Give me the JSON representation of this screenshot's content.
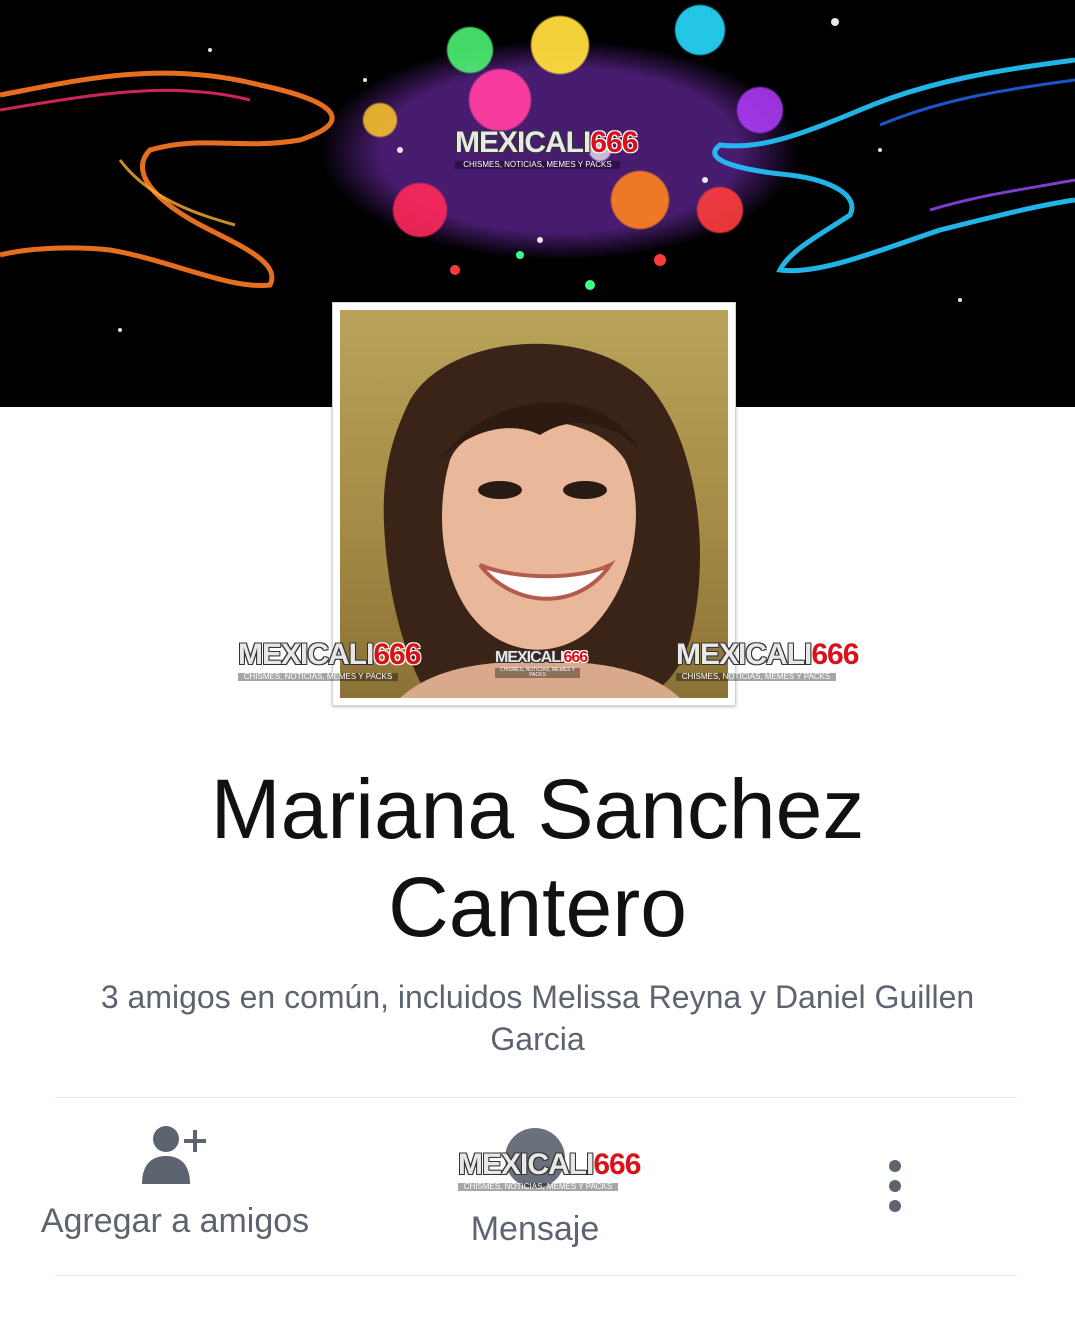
{
  "cover": {
    "watermark": {
      "brand": "MEXICALI",
      "number": "666",
      "tagline": "CHISMES, NOTICIAS, MEMES Y PACKS"
    }
  },
  "avatar": {
    "watermarks": [
      {
        "brand": "MEXICALI",
        "number": "666",
        "tagline": "CHISMES, NOTICIAS, MEMES Y PACKS"
      },
      {
        "brand": "MEXICALI",
        "number": "666",
        "tagline": "CHISMES, NOTICIAS, MEMES Y PACKS"
      },
      {
        "brand": "MEXICALI",
        "number": "666",
        "tagline": "CHISMES, NOTICIAS, MEMES Y PACKS"
      }
    ]
  },
  "profile": {
    "name_line1": "Mariana Sanchez",
    "name_line2": "Cantero",
    "mutual_line1": "3 amigos en común, incluidos Melissa Reyna y Daniel Guillen",
    "mutual_line2": "Garcia"
  },
  "actions": {
    "add_friend": {
      "label": "Agregar a amigos",
      "icon": "add-friend-icon"
    },
    "message": {
      "label": "Mensaje",
      "watermark": {
        "brand": "MEXICALI",
        "number": "666",
        "tagline": "CHISMES, NOTICIAS, MEMES Y PACKS"
      }
    },
    "more": {
      "icon": "more-vertical-icon"
    }
  },
  "colors": {
    "secondary_text": "#5d6470",
    "divider": "#e4e6eb",
    "watermark_red": "#d8121b"
  }
}
